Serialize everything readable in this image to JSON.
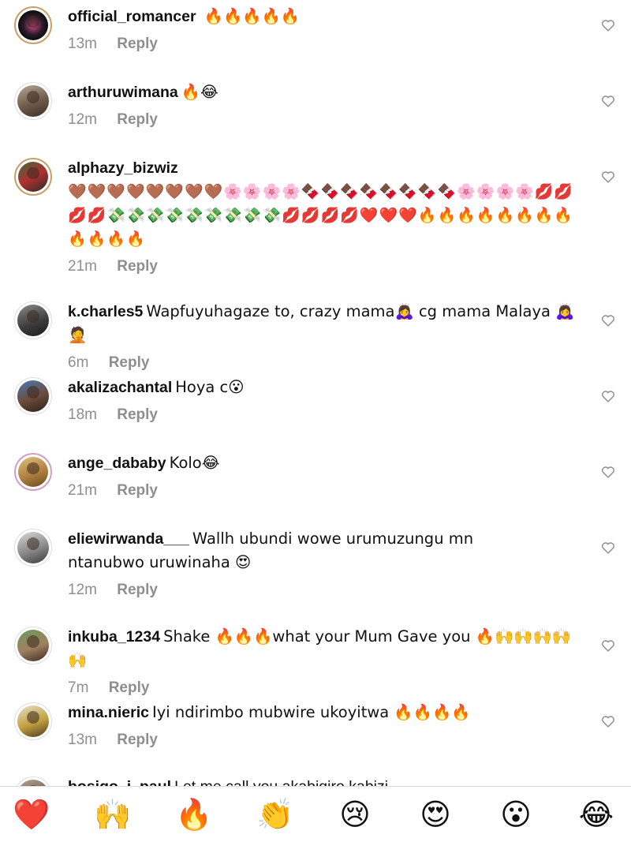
{
  "comments": [
    {
      "username": "official_romancer",
      "text": "",
      "emoji": " 🔥🔥🔥🔥🔥",
      "time": "13m",
      "reply": "Reply",
      "avatar": "avatar-dark-logo"
    },
    {
      "username": "arthuruwimana",
      "text": "",
      "emoji": "🔥😂",
      "time": "12m",
      "reply": "Reply",
      "avatar": "avatar-photo"
    },
    {
      "username": "alphazy_bizwiz",
      "text": "",
      "emoji": "🤎🤎🤎🤎🤎🤎🤎🤎🌸🌸🌸🌸🍫🍫🍫🍫🍫🍫🍫🍫🌸🌸🌸🌸💋💋💋💋💸💸💸💸💸💸💸💸💸💋💋💋💋❤️❤️❤️🔥🔥🔥🔥🔥🔥🔥🔥🔥🔥🔥🔥",
      "time": "21m",
      "reply": "Reply",
      "avatar": "avatar-photo-ring"
    },
    {
      "username": "k.charles5",
      "text": "Wapfuyuhagaze to, crazy mama🙇‍♀️ cg mama Malaya 🙇‍♀️🤦",
      "emoji": "",
      "time": "6m",
      "reply": "Reply",
      "avatar": "avatar-photo"
    },
    {
      "username": "akalizachantal",
      "text": "Hoya c😮",
      "emoji": "",
      "time": "18m",
      "reply": "Reply",
      "avatar": "avatar-photo"
    },
    {
      "username": "ange_dababy",
      "text": "Kolo😂",
      "emoji": "",
      "time": "21m",
      "reply": "Reply",
      "avatar": "avatar-photo-ring"
    },
    {
      "username": "eliewirwanda___",
      "text": "Wallh ubundi wowe urumuzungu mn ntanubwo uruwinaha 😍",
      "emoji": "",
      "time": "12m",
      "reply": "Reply",
      "avatar": "avatar-photo"
    },
    {
      "username": "inkuba_1234",
      "text": "Shake 🔥🔥🔥what your Mum Gave you 🔥🙌🙌🙌🙌🙌",
      "emoji": "",
      "time": "7m",
      "reply": "Reply",
      "avatar": "avatar-photo"
    },
    {
      "username": "mina.nieric",
      "text": "Iyi ndirimbo mubwire ukoyitwa 🔥🔥🔥🔥",
      "emoji": "",
      "time": "13m",
      "reply": "Reply",
      "avatar": "avatar-photo"
    },
    {
      "username": "bosigo_j_paul",
      "text": "Let me call you akabigiro kabizi",
      "emoji": "",
      "time": "",
      "reply": "",
      "avatar": "avatar-photo"
    }
  ],
  "reactions": [
    {
      "emoji": "❤️",
      "name": "heart"
    },
    {
      "emoji": "🙌",
      "name": "raised-hands"
    },
    {
      "emoji": "🔥",
      "name": "fire"
    },
    {
      "emoji": "👏",
      "name": "clapping-hands"
    },
    {
      "emoji": "😢",
      "name": "crying-face"
    },
    {
      "emoji": "😍",
      "name": "heart-eyes"
    },
    {
      "emoji": "😮",
      "name": "surprised-face"
    },
    {
      "emoji": "😂",
      "name": "tears-of-joy"
    }
  ],
  "like_icon": "heart-outline-icon",
  "colors": {
    "text": "#111111",
    "meta": "#8e8e8e",
    "divider": "#dbdbdb",
    "like_outline": "#8e8e8e"
  }
}
